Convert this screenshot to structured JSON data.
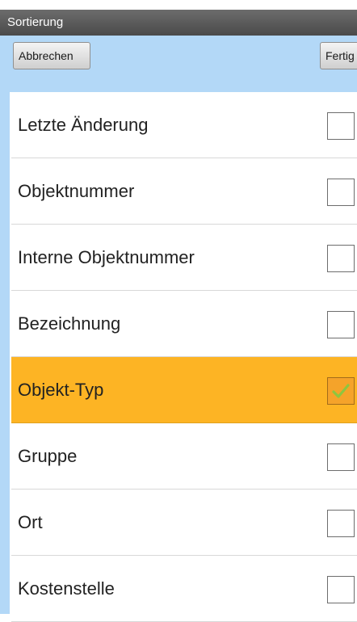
{
  "window": {
    "title": "Sortierung"
  },
  "toolbar": {
    "cancel_label": "Abbrechen",
    "done_label": "Fertig"
  },
  "sort_options": [
    {
      "label": "Letzte Änderung",
      "checked": false
    },
    {
      "label": "Objektnummer",
      "checked": false
    },
    {
      "label": "Interne Objektnummer",
      "checked": false
    },
    {
      "label": "Bezeichnung",
      "checked": false
    },
    {
      "label": "Objekt-Typ",
      "checked": true
    },
    {
      "label": "Gruppe",
      "checked": false
    },
    {
      "label": "Ort",
      "checked": false
    },
    {
      "label": "Kostenstelle",
      "checked": false
    }
  ],
  "colors": {
    "toolbar": "#b3d8f7",
    "selected_row": "#fdb424",
    "checkmark": "#8dc63f"
  },
  "icons": {
    "checkbox_checked": "checkmark-icon"
  }
}
